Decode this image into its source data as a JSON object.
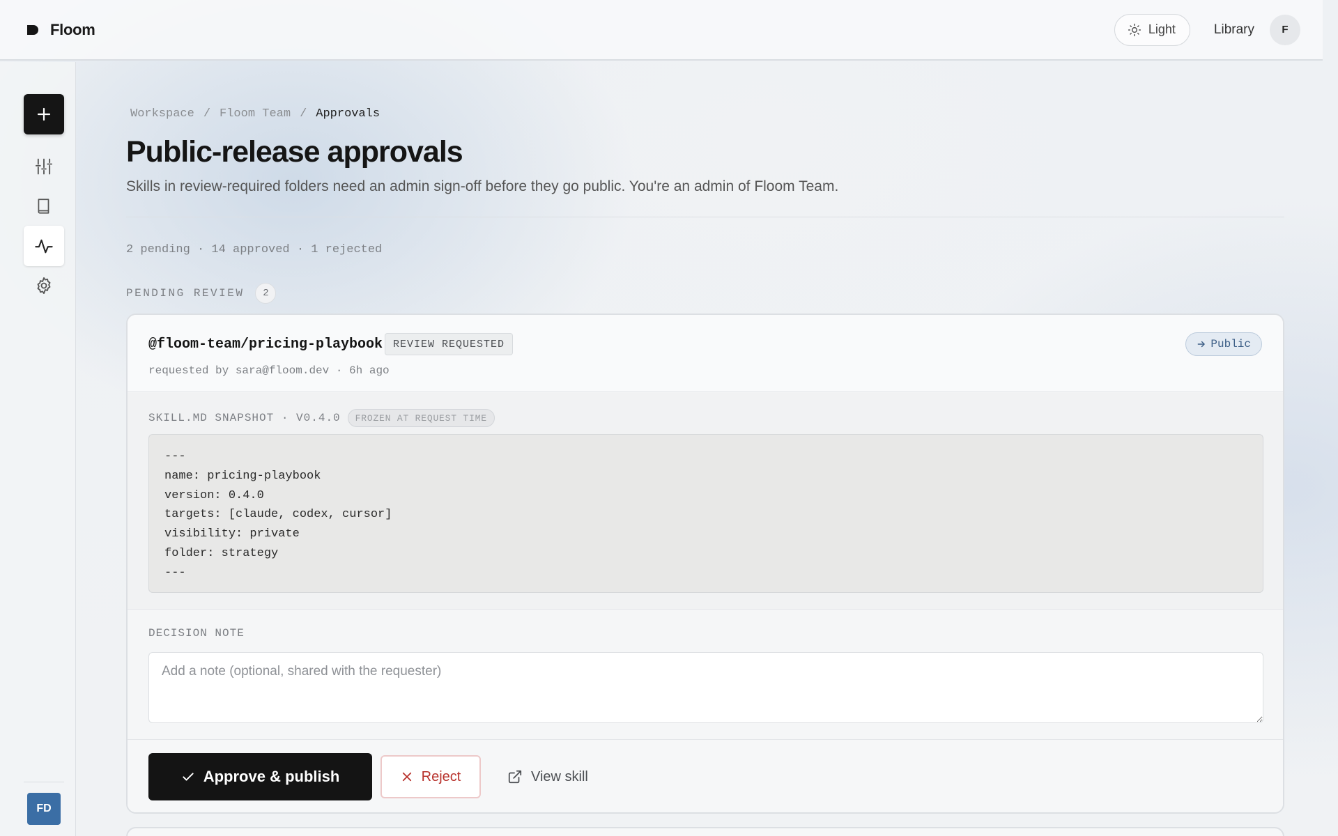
{
  "app": {
    "name": "Floom"
  },
  "header": {
    "theme_label": "Light",
    "library_label": "Library",
    "avatar_initial": "F"
  },
  "rail": {
    "user_initials": "FD"
  },
  "breadcrumb": {
    "items": [
      "Workspace",
      "Floom Team",
      "Approvals"
    ],
    "separator": "/"
  },
  "page": {
    "title": "Public-release approvals",
    "subtitle": "Skills in review-required folders need an admin sign-off before they go public. You're an admin of Floom Team."
  },
  "stats": {
    "text": "2 pending · 14 approved · 1 rejected"
  },
  "section": {
    "label": "PENDING REVIEW",
    "count": "2"
  },
  "request": {
    "skill_name": "@floom-team/pricing-playbook",
    "status_badge": "REVIEW REQUESTED",
    "requested_by": "requested by sara@floom.dev · 6h ago",
    "target": "Public",
    "snapshot_label": "SKILL.MD SNAPSHOT · V0.4.0",
    "frozen_badge": "FROZEN AT REQUEST TIME",
    "snapshot_lines": [
      "---",
      "name: pricing-playbook",
      "version: 0.4.0",
      "targets: [claude, codex, cursor]",
      "visibility: private",
      "folder: strategy",
      "---"
    ],
    "note_label": "DECISION NOTE",
    "note_placeholder": "Add a note (optional, shared with the requester)",
    "note_value": "",
    "approve_label": "Approve & publish",
    "reject_label": "Reject",
    "view_label": "View skill"
  },
  "colors": {
    "accent_dark": "#141414",
    "reject_red": "#b8322c",
    "public_blue": "#3c5e86",
    "user_blue": "#3b6ea5"
  },
  "icons": {
    "brand": "floom-logo-icon",
    "theme": "sun-icon",
    "new": "plus-icon",
    "nav": [
      "sliders-icon",
      "book-icon",
      "activity-icon",
      "gear-icon"
    ],
    "approve": "check-icon",
    "reject": "x-icon",
    "view": "external-link-icon",
    "target": "arrow-right-icon"
  }
}
